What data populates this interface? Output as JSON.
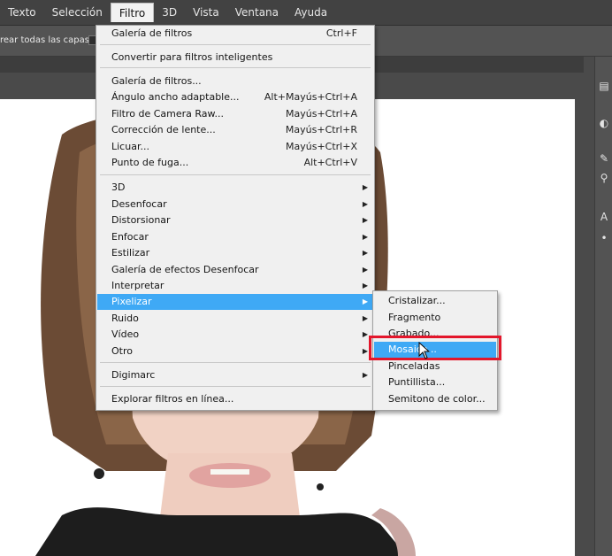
{
  "menubar": {
    "items": [
      {
        "label": "Texto",
        "active": false
      },
      {
        "label": "Selección",
        "active": false
      },
      {
        "label": "Filtro",
        "active": true
      },
      {
        "label": "3D",
        "active": false
      },
      {
        "label": "Vista",
        "active": false
      },
      {
        "label": "Ventana",
        "active": false
      },
      {
        "label": "Ayuda",
        "active": false
      }
    ]
  },
  "options_bar": {
    "label": "rear todas las capas"
  },
  "filter_menu": {
    "items": [
      {
        "label": "Galería de filtros",
        "shortcut": "Ctrl+F"
      },
      {
        "label": "Convertir para filtros inteligentes"
      },
      {
        "label": "Galería de filtros..."
      },
      {
        "label": "Ángulo ancho adaptable...",
        "shortcut": "Alt+Mayús+Ctrl+A"
      },
      {
        "label": "Filtro de Camera Raw...",
        "shortcut": "Mayús+Ctrl+A"
      },
      {
        "label": "Corrección de lente...",
        "shortcut": "Mayús+Ctrl+R"
      },
      {
        "label": "Licuar...",
        "shortcut": "Mayús+Ctrl+X"
      },
      {
        "label": "Punto de fuga...",
        "shortcut": "Alt+Ctrl+V"
      },
      {
        "label": "3D",
        "submenu": true
      },
      {
        "label": "Desenfocar",
        "submenu": true
      },
      {
        "label": "Distorsionar",
        "submenu": true
      },
      {
        "label": "Enfocar",
        "submenu": true
      },
      {
        "label": "Estilizar",
        "submenu": true
      },
      {
        "label": "Galería de efectos Desenfocar",
        "submenu": true
      },
      {
        "label": "Interpretar",
        "submenu": true
      },
      {
        "label": "Pixelizar",
        "submenu": true,
        "highlight": true
      },
      {
        "label": "Ruido",
        "submenu": true
      },
      {
        "label": "Vídeo",
        "submenu": true
      },
      {
        "label": "Otro",
        "submenu": true
      },
      {
        "label": "Digimarc",
        "submenu": true
      },
      {
        "label": "Explorar filtros en línea..."
      }
    ]
  },
  "pixelizar_submenu": {
    "items": [
      {
        "label": "Cristalizar..."
      },
      {
        "label": "Fragmento"
      },
      {
        "label": "Grabado..."
      },
      {
        "label": "Mosaico...",
        "highlight": true
      },
      {
        "label": "Pinceladas"
      },
      {
        "label": "Puntillista..."
      },
      {
        "label": "Semitono de color..."
      }
    ]
  },
  "colors": {
    "menu_highlight": "#3fa9f5",
    "annotation_red": "#e3162b",
    "menubar_bg": "#424242"
  },
  "icons": [
    "arrow-pointer-icon",
    "submenu-arrow-icon"
  ]
}
